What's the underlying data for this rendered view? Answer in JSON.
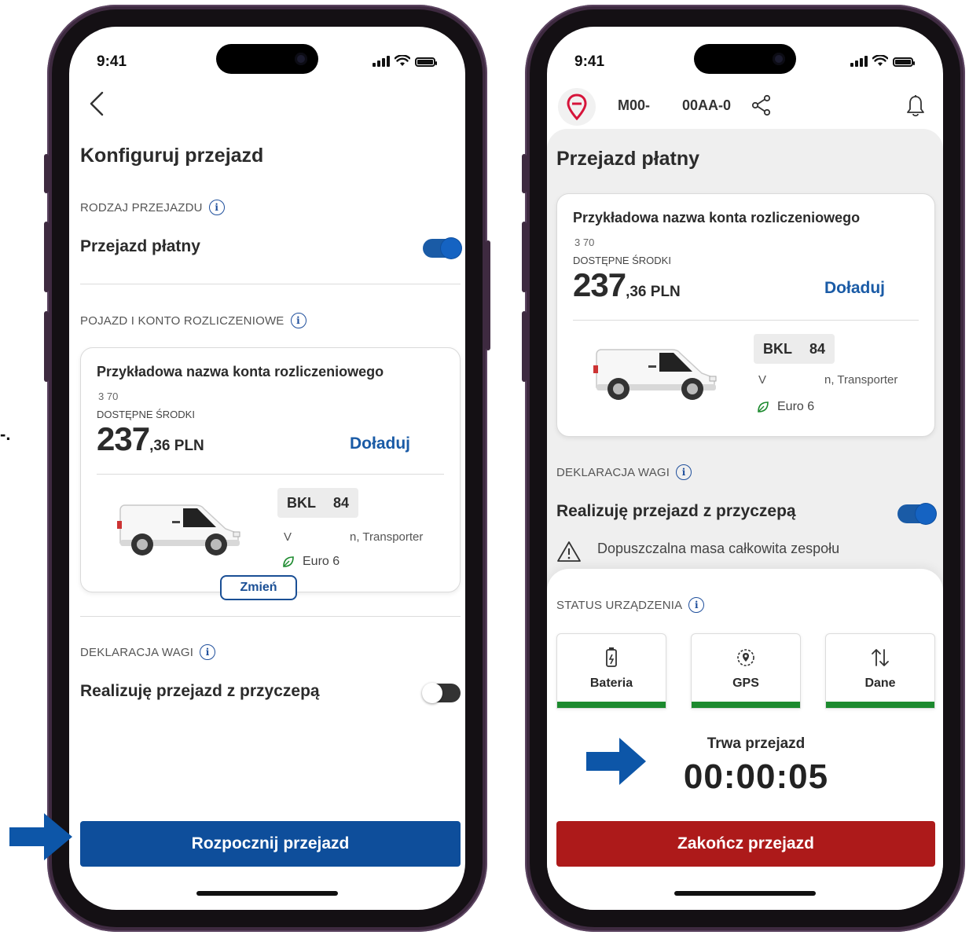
{
  "status_bar": {
    "time": "9:41"
  },
  "config_screen": {
    "title": "Konfiguruj przejazd",
    "trip_type_caption": "RODZAJ PRZEJAZDU",
    "trip_type_label": "Przejazd płatny",
    "trip_type_enabled": true,
    "vehicle_caption": "POJAZD I KONTO ROZLICZENIOWE",
    "account": {
      "name": "Przykładowa nazwa konta rozliczeniowego",
      "number": "3   70",
      "funds_label": "DOSTĘPNE ŚRODKI",
      "amount_int": "237",
      "amount_dec": ",36 PLN",
      "topup_label": "Doładuj"
    },
    "vehicle": {
      "plate_a": "BKL",
      "plate_b": "84",
      "model_a": "V",
      "model_b": "n, Transporter",
      "emission": "Euro 6"
    },
    "change_label": "Zmień",
    "weight_caption": "DEKLARACJA WAGI",
    "trailer_label": "Realizuję przejazd z przyczepą",
    "trailer_enabled": false,
    "start_label": "Rozpocznij przejazd"
  },
  "trip_screen": {
    "header": {
      "plate_a": "M00-",
      "plate_b": "00AA-0"
    },
    "title": "Przejazd płatny",
    "account": {
      "name": "Przykładowa nazwa konta rozliczeniowego",
      "number": "3   70",
      "funds_label": "DOSTĘPNE ŚRODKI",
      "amount_int": "237",
      "amount_dec": ",36 PLN",
      "topup_label": "Doładuj"
    },
    "vehicle": {
      "plate_a": "BKL",
      "plate_b": "84",
      "model_a": "V",
      "model_b": "n, Transporter",
      "emission": "Euro 6"
    },
    "weight_caption": "DEKLARACJA WAGI",
    "trailer_label": "Realizuję przejazd z przyczepą",
    "trailer_enabled": true,
    "warning_text": "Dopuszczalna masa całkowita zespołu",
    "device_caption": "STATUS URZĄDZENIA",
    "tiles": [
      {
        "label": "Bateria",
        "icon": "battery-icon"
      },
      {
        "label": "GPS",
        "icon": "gps-icon"
      },
      {
        "label": "Dane",
        "icon": "data-transfer-icon"
      }
    ],
    "status_color": "#1c8a2e",
    "trip_status": "Trwa przejazd",
    "timer": "00:00:05",
    "end_label": "Zakończ przejazd"
  },
  "colors": {
    "primary": "#0e4e9b",
    "danger": "#ad1a1a",
    "accent_arrow": "#0d56a8"
  }
}
